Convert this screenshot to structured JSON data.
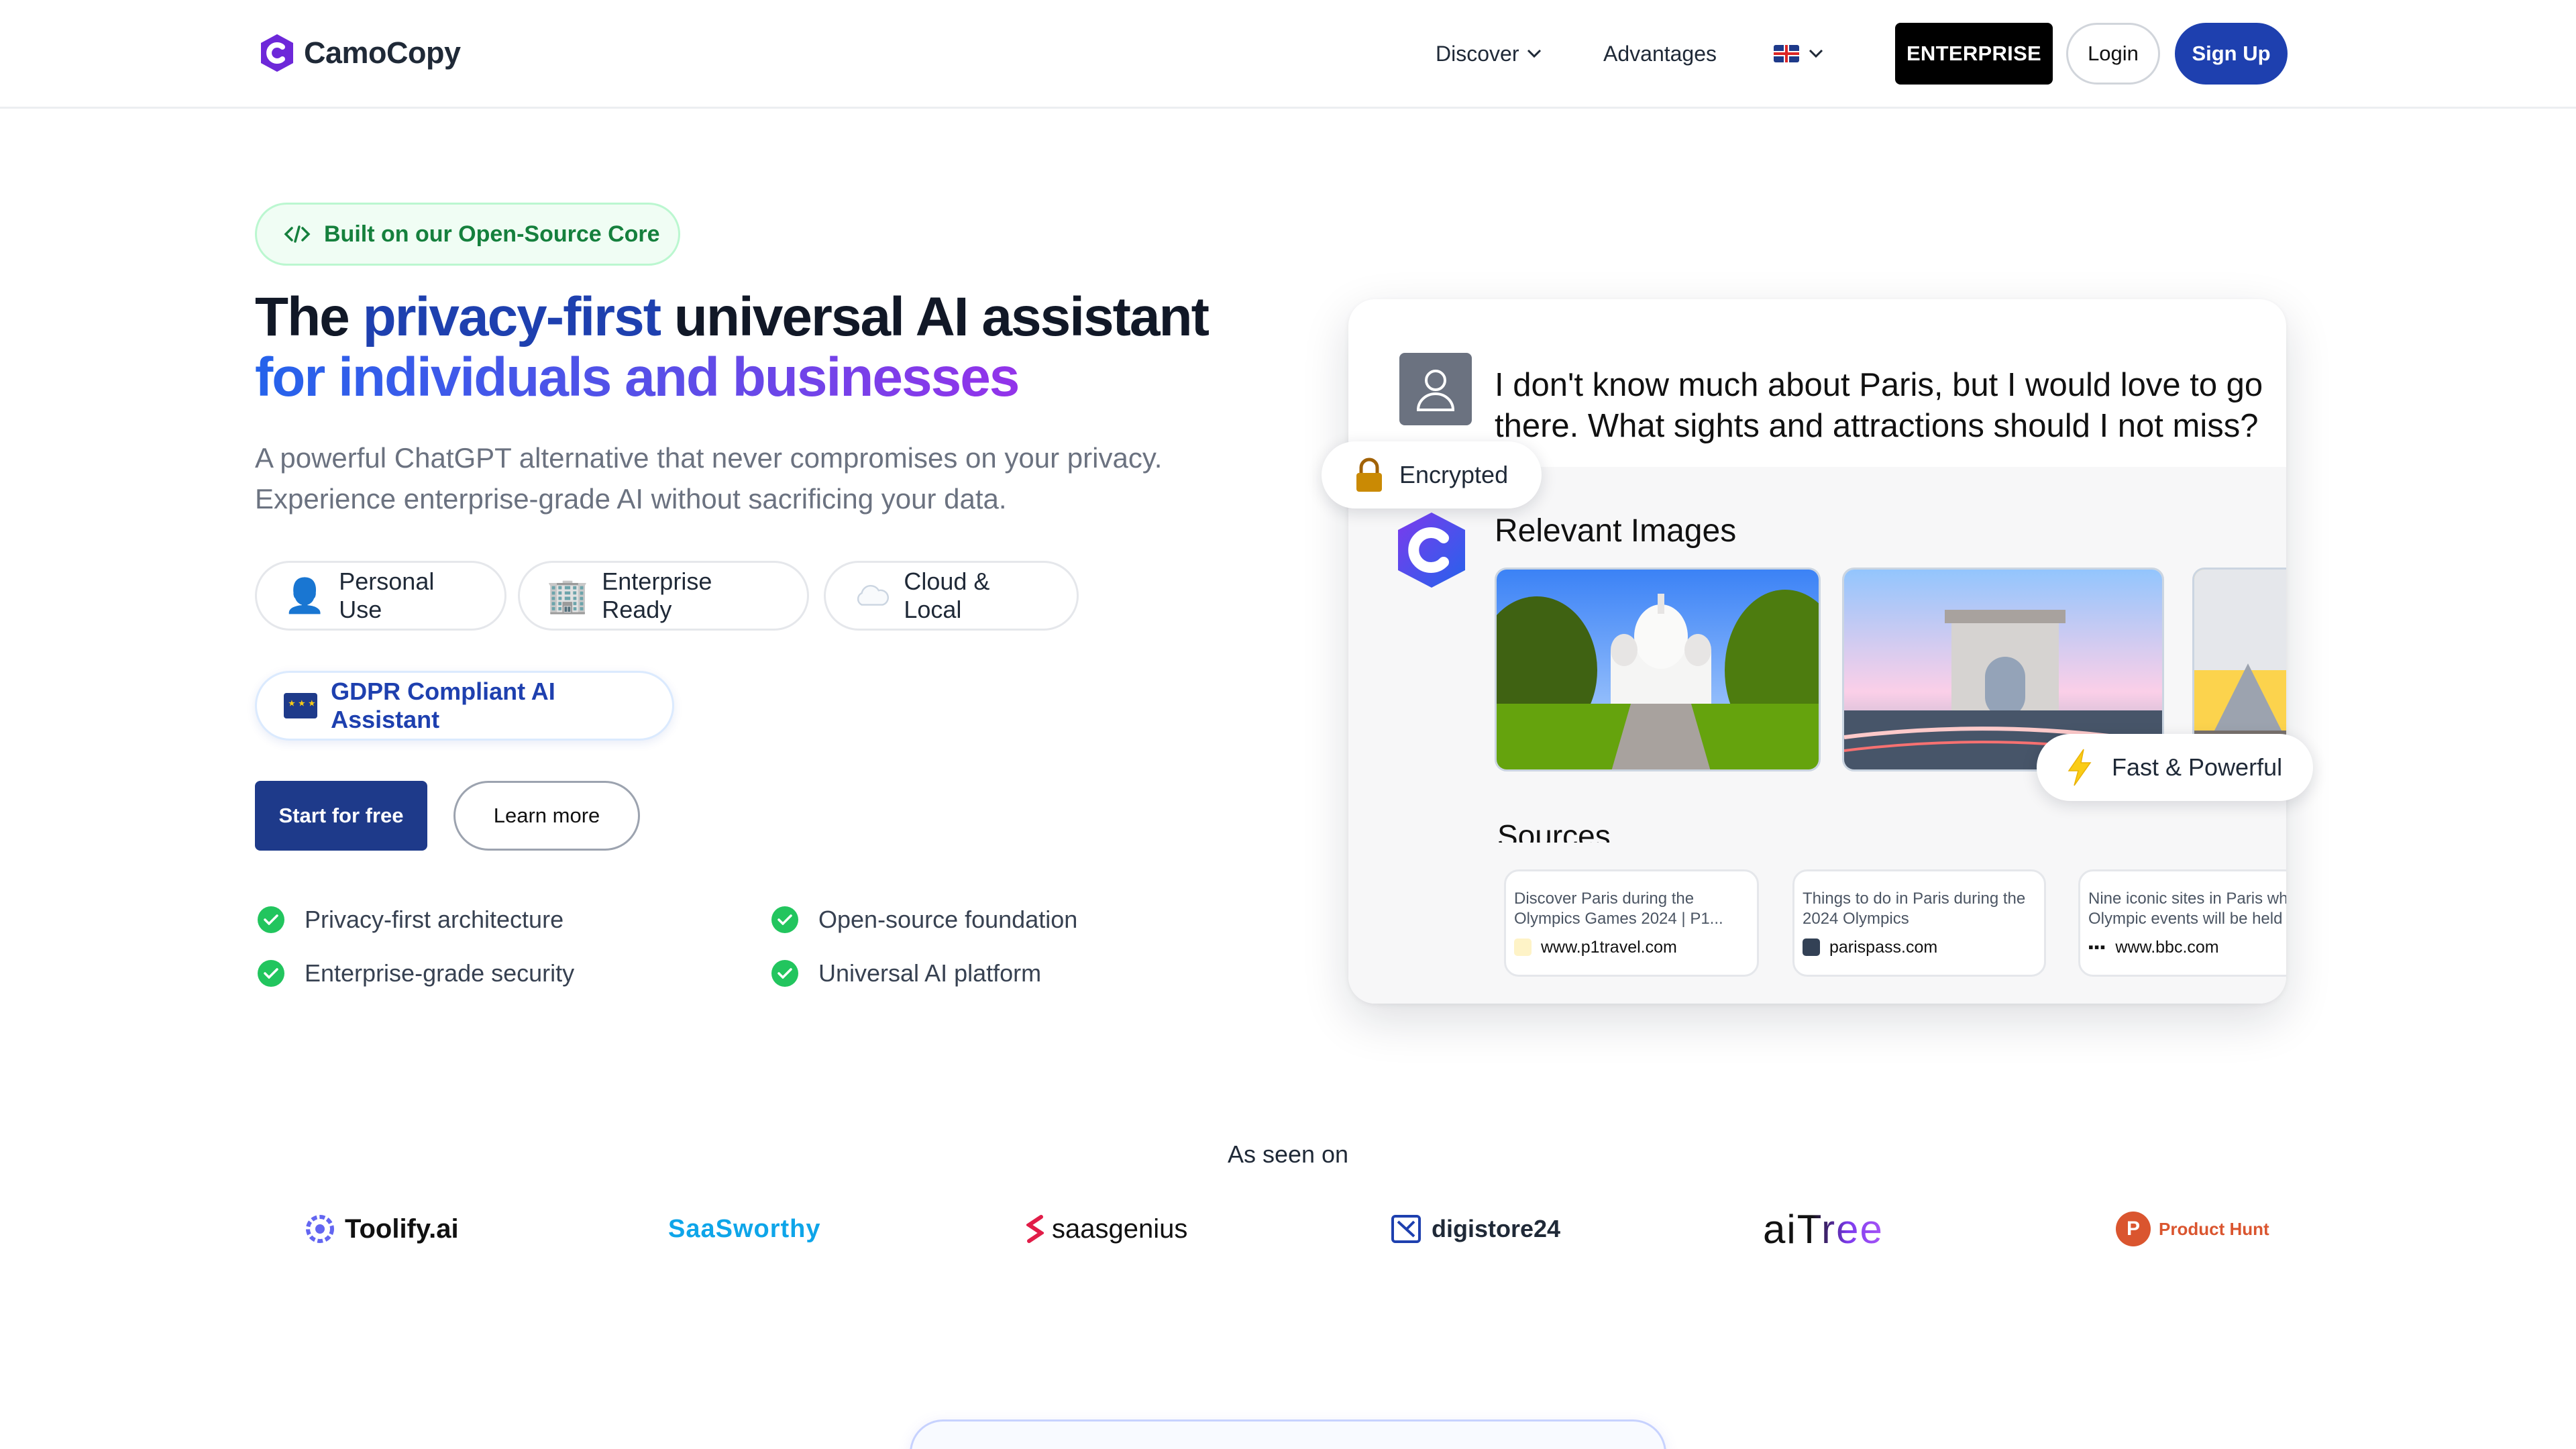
{
  "header": {
    "brand": "CamoCopy",
    "nav": {
      "discover": "Discover",
      "advantages": "Advantages"
    },
    "buttons": {
      "enterprise": "ENTERPRISE",
      "login": "Login",
      "signup": "Sign Up"
    }
  },
  "hero": {
    "badge": "Built on our Open-Source Core",
    "title": {
      "part1": "The ",
      "highlight": "privacy-first",
      "part2": " universal AI assistant",
      "line2": "for individuals and businesses"
    },
    "subtitle_line1": "A powerful ChatGPT alternative that never compromises on your privacy.",
    "subtitle_line2": "Experience enterprise-grade AI without sacrificing your data.",
    "pills": {
      "personal": "Personal Use",
      "enterprise": "Enterprise Ready",
      "cloud": "Cloud & Local",
      "gdpr": "GDPR Compliant AI Assistant"
    },
    "cta": {
      "start": "Start for free",
      "learn": "Learn more"
    },
    "features": [
      "Privacy-first architecture",
      "Open-source foundation",
      "Enterprise-grade security",
      "Universal AI platform"
    ]
  },
  "demo": {
    "user_message": "I don't know much about Paris, but I would love to go there. What sights and attractions should I not miss?",
    "encrypted": "Encrypted",
    "relevant_images": "Relevant Images",
    "fast": "Fast & Powerful",
    "sources_title": "Sources",
    "sources": [
      {
        "title": "Discover Paris during the Olympics Games 2024 | P1...",
        "url": "www.p1travel.com"
      },
      {
        "title": "Things to do in Paris during the 2024 Olympics",
        "url": "parispass.com"
      },
      {
        "title": "Nine iconic sites in Paris wh Olympic events will be held",
        "url": "www.bbc.com"
      }
    ]
  },
  "seen_on": {
    "title": "As seen on",
    "brands": {
      "toolify": "Toolify.ai",
      "saasworthy": "SaaSworthy",
      "saasgenius": "saasgenius",
      "digistore": "digistore24",
      "aitree": "aiTree",
      "producthunt": "Product Hunt"
    }
  },
  "colors": {
    "primary": "#1e40af",
    "dark_primary": "#1e3a8a",
    "success": "#22c55e",
    "accent_purple": "#9333ea"
  }
}
